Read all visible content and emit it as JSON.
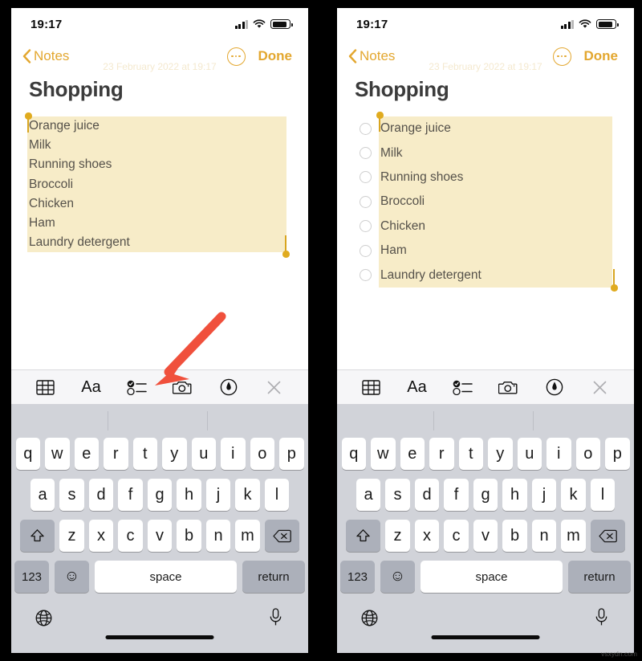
{
  "status_bar": {
    "time": "19:17"
  },
  "nav": {
    "back_label": "Notes",
    "done_label": "Done",
    "note_date": "23 February 2022 at 19:17"
  },
  "note": {
    "title": "Shopping",
    "items": [
      "Orange juice",
      "Milk",
      "Running shoes",
      "Broccoli",
      "Chicken",
      "Ham",
      "Laundry detergent"
    ]
  },
  "format_toolbar": {
    "buttons": [
      {
        "name": "table-icon",
        "label": "table"
      },
      {
        "name": "text-format-icon",
        "label": "Aa"
      },
      {
        "name": "checklist-icon",
        "label": "checklist"
      },
      {
        "name": "camera-icon",
        "label": "camera"
      },
      {
        "name": "markup-pen-icon",
        "label": "markup"
      },
      {
        "name": "close-icon",
        "label": "close"
      }
    ]
  },
  "keyboard": {
    "row1": [
      "q",
      "w",
      "e",
      "r",
      "t",
      "y",
      "u",
      "i",
      "o",
      "p"
    ],
    "row2": [
      "a",
      "s",
      "d",
      "f",
      "g",
      "h",
      "j",
      "k",
      "l"
    ],
    "row3": [
      "z",
      "x",
      "c",
      "v",
      "b",
      "n",
      "m"
    ],
    "shift_label": "",
    "backspace_label": "",
    "numbers_label": "123",
    "emoji_label": "☺",
    "space_label": "space",
    "return_label": "return"
  },
  "annotation": {
    "arrow_color": "#f0503c",
    "points_to": "checklist-icon"
  },
  "watermark": "vsxydn.com",
  "colors": {
    "accent_yellow": "#e3a72f",
    "highlight_yellow": "#f7ecc8",
    "handle_yellow": "#e0ab1f",
    "keyboard_bg": "#d1d3d9"
  }
}
